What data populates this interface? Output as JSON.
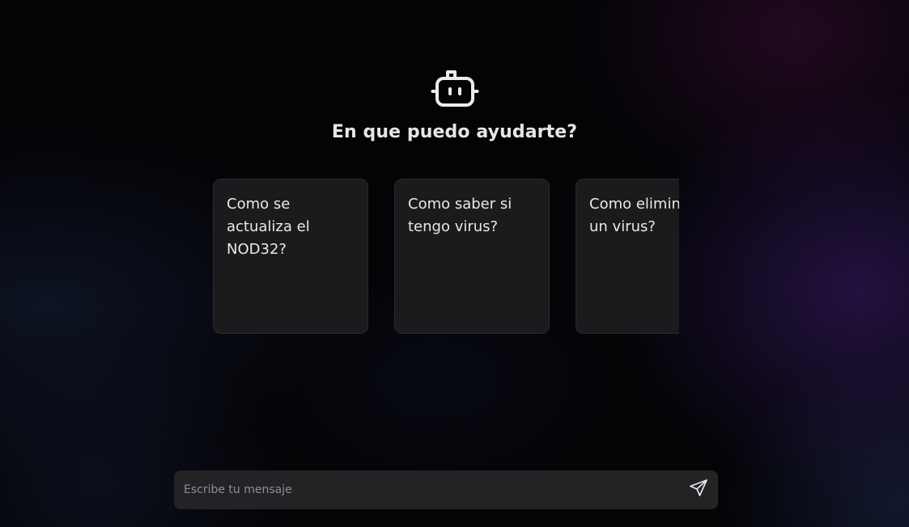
{
  "hero": {
    "icon": "bot-icon",
    "title": "En que puedo ayudarte?"
  },
  "suggestions": [
    {
      "text": "Como se\nactualiza el\nNOD32?"
    },
    {
      "text": "Como saber si\ntengo virus?"
    },
    {
      "text": "Como eliminar\nun virus?"
    }
  ],
  "composer": {
    "placeholder": "Escribe tu mensaje",
    "value": "",
    "send_icon": "send-icon"
  },
  "colors": {
    "background": "#040407",
    "card": "#1b1b1e",
    "input": "#232326",
    "text": "#e9e9ec",
    "placeholder": "#8e8e94"
  }
}
